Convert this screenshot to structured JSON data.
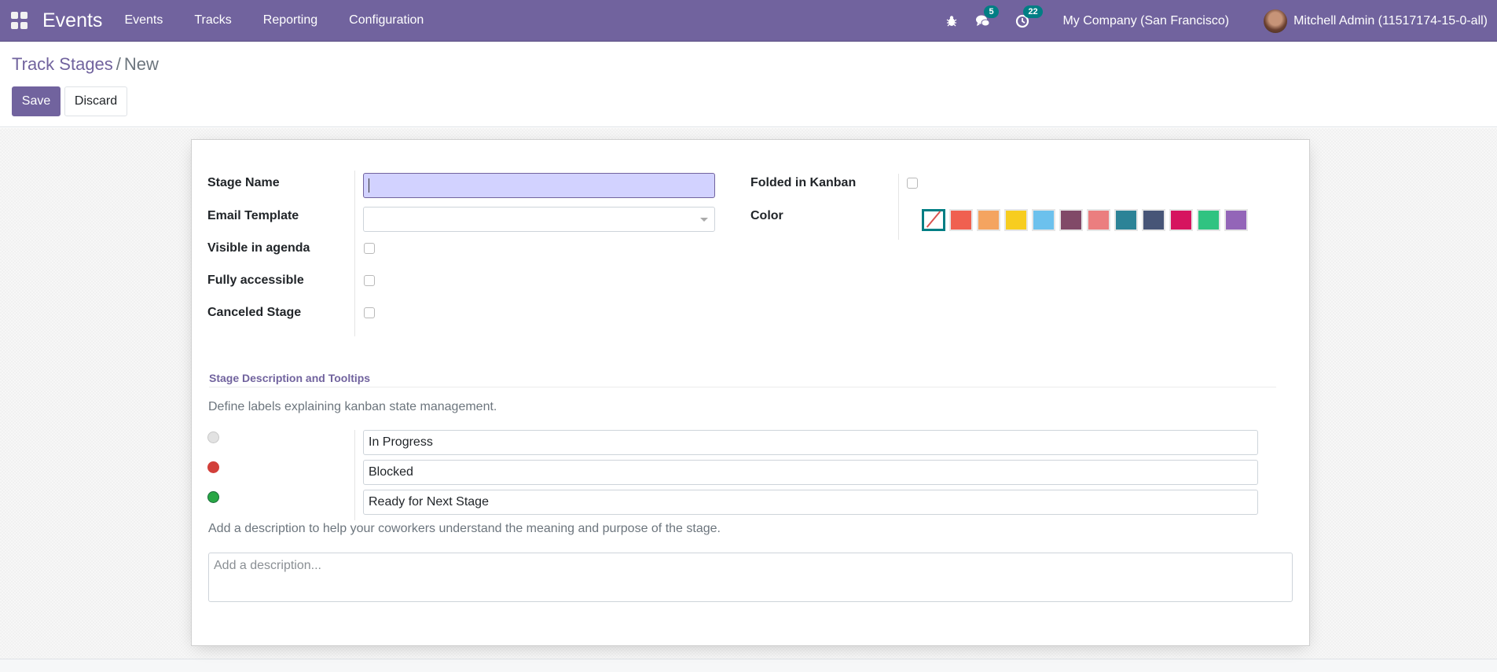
{
  "navbar": {
    "app_name": "Events",
    "menu": [
      "Events",
      "Tracks",
      "Reporting",
      "Configuration"
    ],
    "icons": [
      "apps-grid-icon",
      "bug-icon",
      "chat-icon",
      "activity-clock-icon"
    ],
    "messages_count": "5",
    "activities_count": "22",
    "company": "My Company (San Francisco)",
    "user": "Mitchell Admin (11517174-15-0-all)"
  },
  "control_panel": {
    "breadcrumb_parent": "Track Stages",
    "breadcrumb_separator": "/",
    "breadcrumb_current": "New",
    "save_label": "Save",
    "discard_label": "Discard"
  },
  "form": {
    "stage_name": {
      "label": "Stage Name",
      "value": ""
    },
    "email_template": {
      "label": "Email Template",
      "value": ""
    },
    "visible_in_agenda": {
      "label": "Visible in agenda",
      "checked": false
    },
    "fully_accessible": {
      "label": "Fully accessible",
      "checked": false
    },
    "canceled_stage": {
      "label": "Canceled Stage",
      "checked": false
    },
    "folded_in_kanban": {
      "label": "Folded in Kanban",
      "checked": false
    },
    "color": {
      "label": "Color",
      "selected_index": 0,
      "swatches": [
        "#ffffff",
        "#f06050",
        "#f4a460",
        "#f7cd1f",
        "#6cc1ed",
        "#814968",
        "#eb7e7f",
        "#2c8397",
        "#475577",
        "#d6145f",
        "#30c381",
        "#9365b8"
      ]
    }
  },
  "tooltips_section": {
    "title": "Stage Description and Tooltips",
    "help": "Define labels explaining kanban state management.",
    "states": [
      {
        "color": "#e2e2e2",
        "value": "In Progress"
      },
      {
        "color": "#d23f3a",
        "value": "Blocked"
      },
      {
        "color": "#28a745",
        "value": "Ready for Next Stage"
      }
    ],
    "description_help": "Add a description to help your coworkers understand the meaning and purpose of the stage.",
    "description_placeholder": "Add a description..."
  }
}
